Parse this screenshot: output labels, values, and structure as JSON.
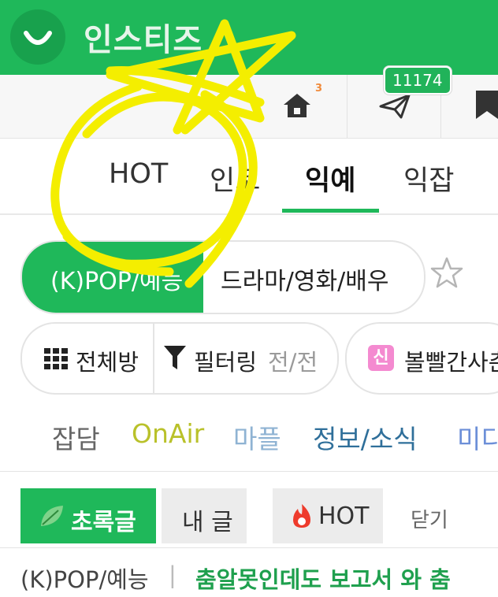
{
  "app": {
    "title": "인스티즈",
    "brand_color": "#1fb85a"
  },
  "icon_bar": {
    "home_badge": "3",
    "message_count": "11174",
    "icons": [
      "home-icon",
      "paper-plane-icon",
      "bookmark-icon"
    ]
  },
  "main_tabs": {
    "items": [
      "HOT",
      "인코",
      "익예",
      "익잡"
    ],
    "active": "익예"
  },
  "category": {
    "active_label": "(K)POP/예능",
    "other_label": "드라마/영화/배우"
  },
  "room_filter": {
    "all_rooms": "전체방",
    "filter_label": "필터링",
    "filter_value": "전/전",
    "new_badge": "신",
    "new_label": "볼빨간사춘"
  },
  "subcategories": [
    {
      "label": "잡담",
      "color": "#666666"
    },
    {
      "label": "OnAir",
      "color": "#b9c12a"
    },
    {
      "label": "마플",
      "color": "#8fb3d3"
    },
    {
      "label": "정보/소식",
      "color": "#2f6f9a"
    },
    {
      "label": "미디",
      "color": "#6c8fd8"
    }
  ],
  "buttons": {
    "green_post": "초록글",
    "my_post": "내 글",
    "hot": "HOT",
    "close": "닫기"
  },
  "breadcrumb": {
    "section": "(K)POP/예능",
    "separator": "|",
    "headline": "춤알못인데도 보고서 와 춤"
  },
  "overlay": {
    "scribble_color": "#f4ee00"
  }
}
